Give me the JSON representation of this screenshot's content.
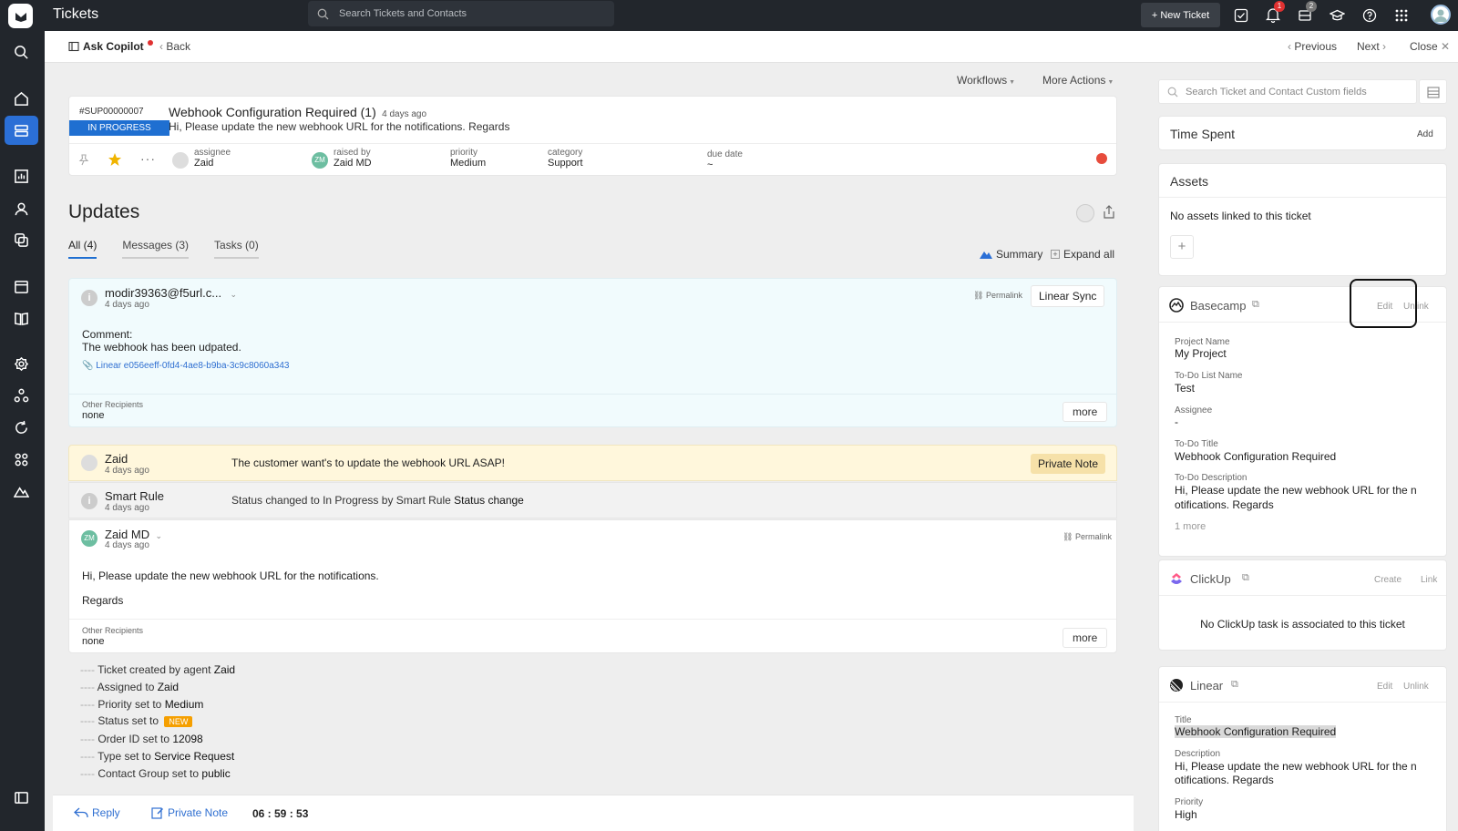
{
  "topbar": {
    "title": "Tickets",
    "search_placeholder": "Search Tickets and Contacts",
    "new_ticket": "+ New Ticket",
    "notif_badge": "1",
    "inbox_badge": "2"
  },
  "subbar": {
    "copilot": "Ask Copilot",
    "back": "Back",
    "previous": "Previous",
    "next": "Next",
    "close": "Close"
  },
  "actions": {
    "workflows": "Workflows",
    "more_actions": "More Actions"
  },
  "ticket": {
    "id": "#SUP00000007",
    "status": "IN PROGRESS",
    "title": "Webhook Configuration Required (1)",
    "age": "4 days ago",
    "summary": "Hi, Please update the new webhook URL for the notifications. Regards",
    "assignee_label": "assignee",
    "assignee": "Zaid",
    "raised_label": "raised by",
    "raised_by": "Zaid MD",
    "raised_initials": "ZM",
    "priority_label": "priority",
    "priority": "Medium",
    "category_label": "category",
    "category": "Support",
    "due_label": "due date",
    "due": "~"
  },
  "updates": {
    "title": "Updates",
    "tabs": [
      "All (4)",
      "Messages (3)",
      "Tasks (0)"
    ],
    "summary": "Summary",
    "expand_all": "Expand all"
  },
  "msg1": {
    "author": "modir39363@f5url.c...",
    "time": "4 days ago",
    "permalink": "Permalink",
    "source": "Linear Sync",
    "line1": "Comment:",
    "line2": "The webhook has been udpated.",
    "attachment": "Linear e056eeff-0fd4-4ae8-b9ba-3c9c8060a343",
    "recipients_label": "Other Recipients",
    "recipients": "none",
    "more": "more"
  },
  "note": {
    "author": "Zaid",
    "time": "4 days ago",
    "text": "The customer want's to update the webhook URL ASAP!",
    "badge": "Private Note"
  },
  "rule": {
    "author": "Smart Rule",
    "time": "4 days ago",
    "text": "Status changed to In Progress by Smart Rule ",
    "text_bold": "Status change"
  },
  "msg2": {
    "author": "Zaid MD",
    "initials": "ZM",
    "time": "4 days ago",
    "permalink": "Permalink",
    "body1": "Hi, Please update the new webhook URL for the notifications.",
    "body2": "Regards",
    "recipients_label": "Other Recipients",
    "recipients": "none",
    "more": "more"
  },
  "activity": [
    {
      "text": "Ticket created by agent ",
      "bold": "Zaid"
    },
    {
      "text": "Assigned to ",
      "bold": "Zaid"
    },
    {
      "text": "Priority set to ",
      "bold": "Medium"
    },
    {
      "text": "Status set to ",
      "badge": "NEW"
    },
    {
      "text": "Order ID set to ",
      "bold": "12098"
    },
    {
      "text": "Type set to ",
      "bold": "Service Request"
    },
    {
      "text": "Contact Group set to ",
      "bold": "public"
    }
  ],
  "composer": {
    "reply": "Reply",
    "private_note": "Private Note",
    "timer": "06 : 59 : 53"
  },
  "right": {
    "search_placeholder": "Search Ticket and Contact Custom fields",
    "time_spent": "Time Spent",
    "add": "Add",
    "assets": "Assets",
    "no_assets": "No assets linked to this ticket",
    "basecamp": {
      "title": "Basecamp",
      "edit": "Edit",
      "unlink": "Unlink",
      "project_label": "Project Name",
      "project": "My Project",
      "todo_list_label": "To-Do List Name",
      "todo_list": "Test",
      "assignee_label": "Assignee",
      "assignee": "-",
      "todo_title_label": "To-Do Title",
      "todo_title": "Webhook Configuration Required",
      "todo_desc_label": "To-Do Description",
      "todo_desc1": "Hi, Please update the new webhook URL for the n",
      "todo_desc2": "otifications. Regards",
      "more": "1 more"
    },
    "clickup": {
      "title": "ClickUp",
      "create": "Create",
      "link": "Link",
      "empty": "No ClickUp task is associated to this ticket"
    },
    "linear": {
      "title": "Linear",
      "edit": "Edit",
      "unlink": "Unlink",
      "title_label": "Title",
      "title_val": "Webhook Configuration Required",
      "desc_label": "Description",
      "desc1": "Hi, Please update the new webhook URL for the n",
      "desc2": "otifications. Regards",
      "priority_label": "Priority",
      "priority": "High"
    }
  },
  "colors": {
    "accent": "#1f5fbf",
    "status_bg": "#1f6fd1",
    "danger": "#e74c3c",
    "note_bg": "#fff7dc",
    "msg_bg": "#f1fbfd"
  }
}
